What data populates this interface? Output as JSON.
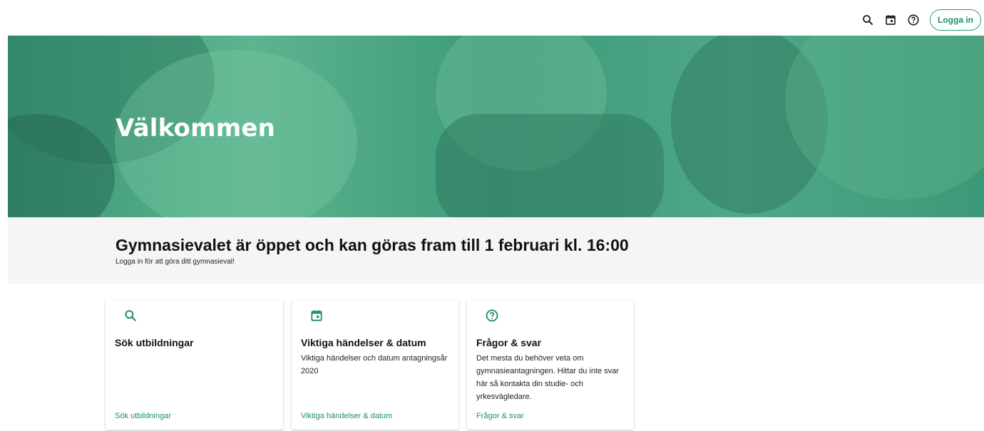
{
  "header": {
    "search_icon": "search-icon",
    "calendar_icon": "calendar-icon",
    "help_icon": "help-circle-icon",
    "login_label": "Logga in"
  },
  "hero": {
    "title": "Välkommen"
  },
  "notice": {
    "title": "Gymnasievalet är öppet och kan göras fram till 1 februari kl. 16:00",
    "subtitle": "Logga in för att göra ditt gymnasieval!"
  },
  "cards": [
    {
      "icon": "search-icon",
      "title": "Sök utbildningar",
      "text": "",
      "link": "Sök utbildningar"
    },
    {
      "icon": "calendar-icon",
      "title": "Viktiga händelser & datum",
      "text": "Viktiga händelser och datum antagningsår 2020",
      "link": "Viktiga händelser & datum"
    },
    {
      "icon": "help-circle-icon",
      "title": "Frågor & svar",
      "text": "Det mesta du behöver veta om gymnasieantagningen. Hittar du inte svar här så kontakta din studie- och yrkesvägledare.",
      "link": "Frågor & svar"
    }
  ],
  "colors": {
    "accent": "#1e8f6f",
    "hero_green": "#45a27f",
    "notice_bg": "#f5f5f5"
  }
}
